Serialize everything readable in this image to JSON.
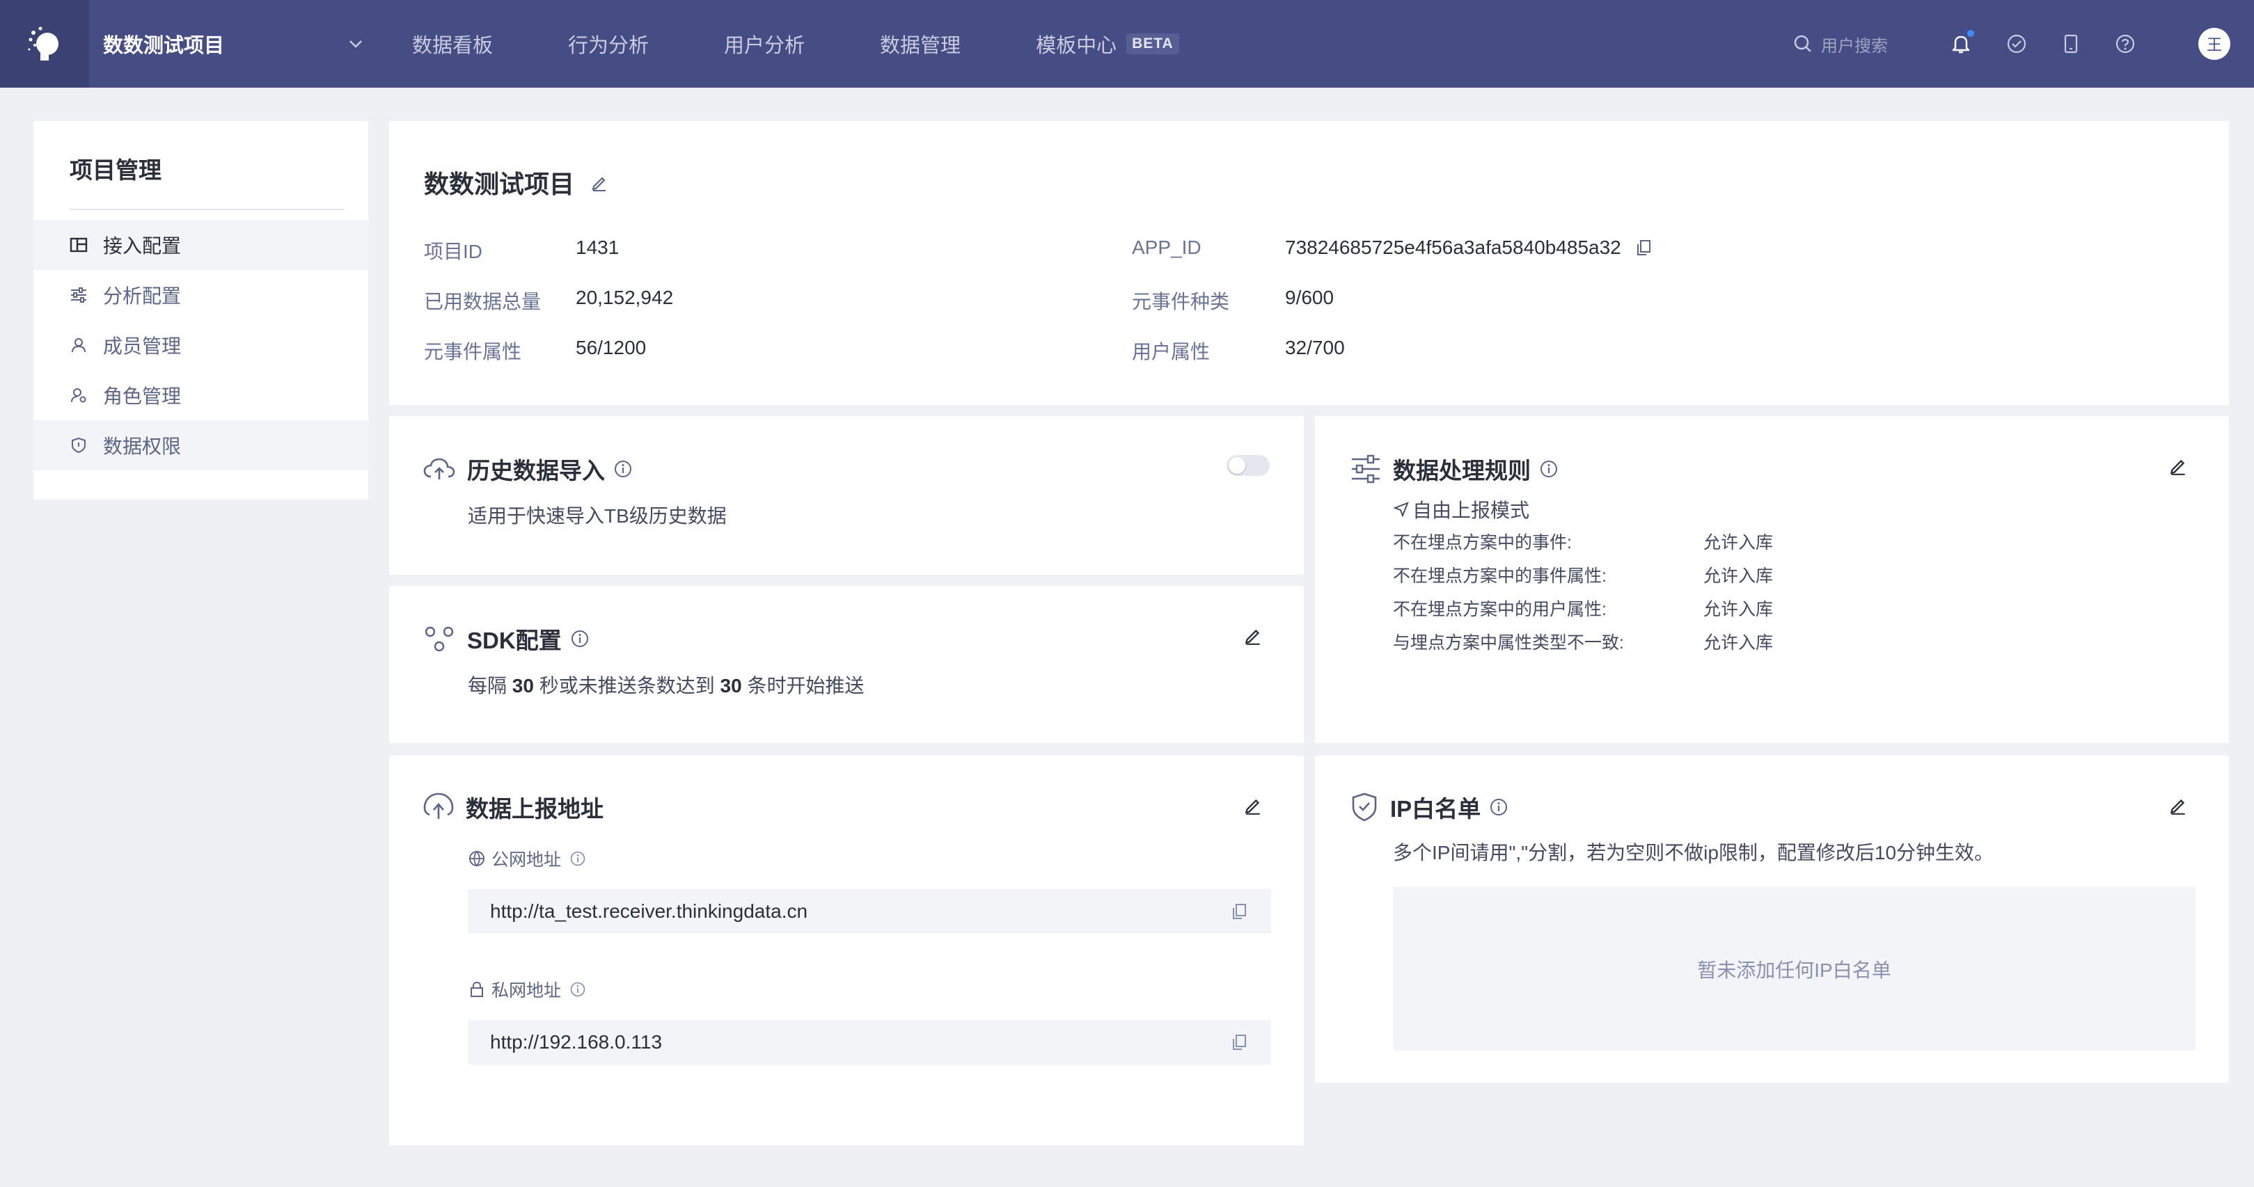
{
  "header": {
    "project_name": "数数测试项目",
    "nav": [
      "数据看板",
      "行为分析",
      "用户分析",
      "数据管理",
      "模板中心"
    ],
    "beta": "BETA",
    "search_placeholder": "用户搜索",
    "avatar": "王"
  },
  "sidebar": {
    "title": "项目管理",
    "items": [
      {
        "label": "接入配置",
        "icon": "panel-icon"
      },
      {
        "label": "分析配置",
        "icon": "sliders-icon"
      },
      {
        "label": "成员管理",
        "icon": "user-icon"
      },
      {
        "label": "角色管理",
        "icon": "user-gear-icon"
      },
      {
        "label": "数据权限",
        "icon": "shield-icon"
      }
    ]
  },
  "project": {
    "title": "数数测试项目",
    "fields": {
      "project_id_label": "项目ID",
      "project_id": "1431",
      "app_id_label": "APP_ID",
      "app_id": "73824685725e4f56a3afa5840b485a32",
      "used_label": "已用数据总量",
      "used": "20,152,942",
      "event_types_label": "元事件种类",
      "event_types": "9/600",
      "event_props_label": "元事件属性",
      "event_props": "56/1200",
      "user_props_label": "用户属性",
      "user_props": "32/700"
    }
  },
  "history_import": {
    "title": "历史数据导入",
    "desc": "适用于快速导入TB级历史数据",
    "enabled": false
  },
  "sdk": {
    "title": "SDK配置",
    "desc_1": "每隔",
    "seconds": "30",
    "desc_2": "秒或未推送条数达到",
    "count": "30",
    "desc_3": "条时开始推送"
  },
  "report_address": {
    "title": "数据上报地址",
    "public_label": "公网地址",
    "public_url": "http://ta_test.receiver.thinkingdata.cn",
    "private_label": "私网地址",
    "private_url": "http://192.168.0.113"
  },
  "rules": {
    "title": "数据处理规则",
    "mode": "自由上报模式",
    "rows": [
      {
        "k": "不在埋点方案中的事件:",
        "v": "允许入库"
      },
      {
        "k": "不在埋点方案中的事件属性:",
        "v": "允许入库"
      },
      {
        "k": "不在埋点方案中的用户属性:",
        "v": "允许入库"
      },
      {
        "k": "与埋点方案中属性类型不一致:",
        "v": "允许入库"
      }
    ]
  },
  "ip_whitelist": {
    "title": "IP白名单",
    "desc": "多个IP间请用\",\"分割，若为空则不做ip限制，配置修改后10分钟生效。",
    "empty": "暂未添加任何IP白名单"
  },
  "colors": {
    "topbar": "#464d84",
    "topbar_dark": "#3b4273",
    "background": "#eff0f4",
    "accent": "#3e8bff"
  }
}
